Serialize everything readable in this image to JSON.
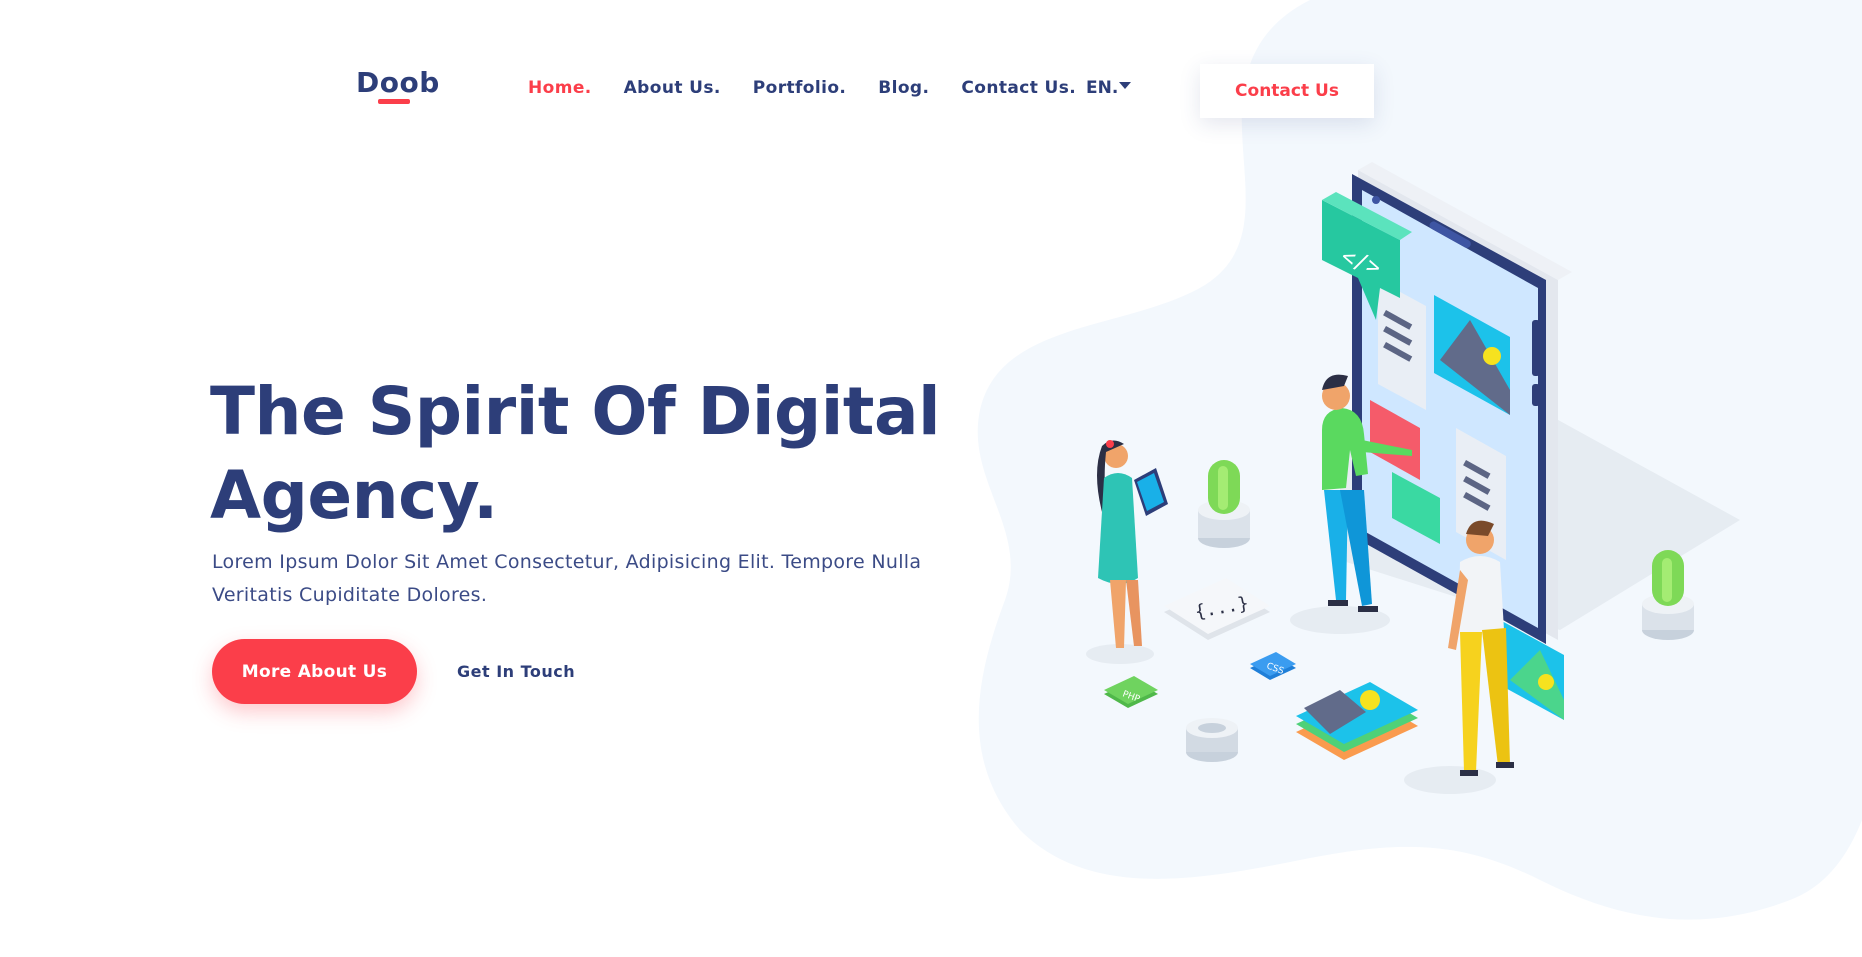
{
  "header": {
    "logo": "Doob",
    "nav": [
      {
        "label": "Home.",
        "active": true
      },
      {
        "label": "About Us.",
        "active": false
      },
      {
        "label": "Portfolio.",
        "active": false
      },
      {
        "label": "Blog.",
        "active": false
      },
      {
        "label": "Contact Us.",
        "active": false
      }
    ],
    "language": "EN.",
    "cta_label": "Contact Us"
  },
  "hero": {
    "title_line1": "The Spirit Of Digital",
    "title_line2": "Agency.",
    "subtitle_line1": "Lorem Ipsum Dolor Sit Amet Consectetur, Adipisicing Elit. Tempore Nulla",
    "subtitle_line2": "Veritatis Cupiditate Dolores.",
    "primary_button": "More About Us",
    "secondary_link": "Get In Touch"
  },
  "illustration": {
    "code_tag": "</>",
    "braces": "{...}",
    "php_label": "PHP",
    "css_label": "CSS"
  },
  "colors": {
    "accent": "#fb3e4a",
    "navy": "#2d3e79",
    "blob": "#f3f8fd"
  }
}
